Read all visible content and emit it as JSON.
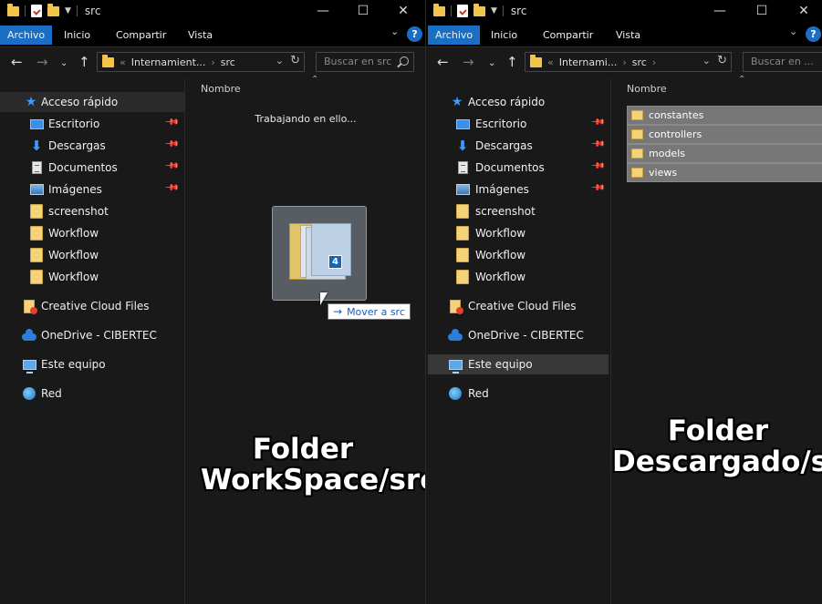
{
  "left_window": {
    "title": "src",
    "ribbon": {
      "file_tab": "Archivo",
      "tabs": [
        "Inicio",
        "Compartir",
        "Vista"
      ],
      "help": "?"
    },
    "address": {
      "overflow": "«",
      "crumbs": [
        "Internamient...",
        "src"
      ]
    },
    "search_placeholder": "Buscar en src",
    "column_header": "Nombre",
    "status_text": "Trabajando en ello...",
    "drag": {
      "count_badge": "4",
      "tooltip": "Mover a src"
    },
    "caption": [
      "Folder",
      "WorkSpace/src"
    ]
  },
  "right_window": {
    "title": "src",
    "ribbon": {
      "file_tab": "Archivo",
      "tabs": [
        "Inicio",
        "Compartir",
        "Vista"
      ],
      "help": "?"
    },
    "address": {
      "overflow": "«",
      "crumbs": [
        "Internami...",
        "src"
      ]
    },
    "search_placeholder": "Buscar en ...",
    "column_header": "Nombre",
    "files": [
      "constantes",
      "controllers",
      "models",
      "views"
    ],
    "caption": [
      "Folder",
      "Descargado/src"
    ]
  },
  "nav": {
    "items": [
      {
        "label": "Acceso rápido",
        "icon": "star-icon"
      },
      {
        "label": "Escritorio",
        "icon": "desktop-icon",
        "pinned": true
      },
      {
        "label": "Descargas",
        "icon": "download-icon",
        "pinned": true
      },
      {
        "label": "Documentos",
        "icon": "document-icon",
        "pinned": true
      },
      {
        "label": "Imágenes",
        "icon": "pictures-icon",
        "pinned": true
      },
      {
        "label": "screenshot",
        "icon": "folder-icon"
      },
      {
        "label": "Workflow",
        "icon": "folder-icon"
      },
      {
        "label": "Workflow",
        "icon": "folder-icon"
      },
      {
        "label": "Workflow",
        "icon": "folder-icon"
      },
      {
        "label": "Creative Cloud Files",
        "icon": "creative-cloud-icon"
      },
      {
        "label": "OneDrive - CIBERTEC",
        "icon": "onedrive-icon"
      },
      {
        "label": "Este equipo",
        "icon": "this-pc-icon"
      },
      {
        "label": "Red",
        "icon": "network-icon"
      }
    ]
  },
  "colors": {
    "accent": "#1a6fc4",
    "background": "#191919",
    "titlebar": "#000000"
  }
}
